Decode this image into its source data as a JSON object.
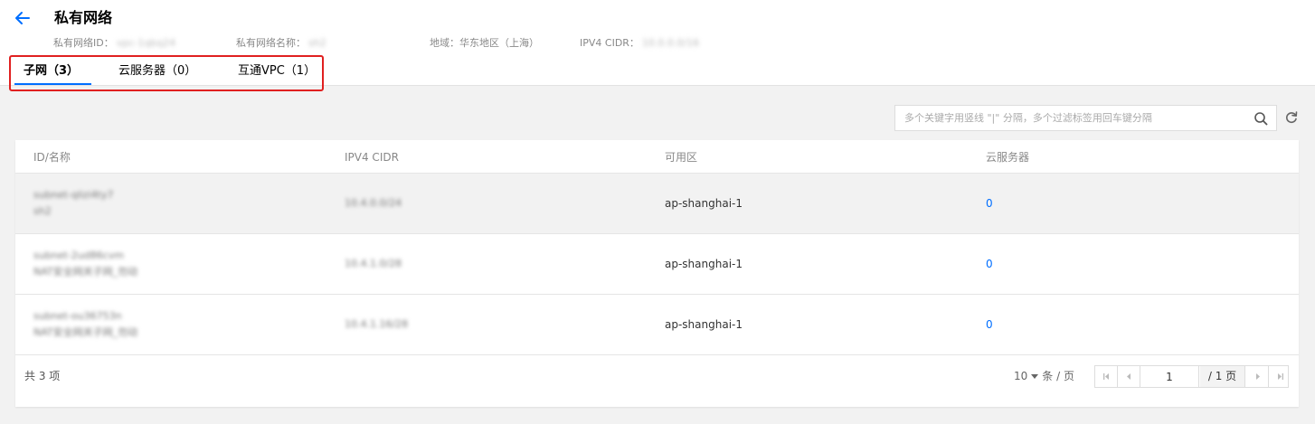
{
  "header": {
    "title": "私有网络",
    "meta": [
      {
        "label": "私有网络ID：",
        "value": "vpc-1qbq24"
      },
      {
        "label": "私有网络名称：",
        "value": "sh2"
      },
      {
        "label": "地域：",
        "value": "华东地区（上海）"
      },
      {
        "label": "IPV4 CIDR：",
        "value": "10.0.0.0/16"
      }
    ]
  },
  "tabs": [
    {
      "label": "子网（3）",
      "active": true
    },
    {
      "label": "云服务器（0）",
      "active": false
    },
    {
      "label": "互通VPC（1）",
      "active": false
    }
  ],
  "search": {
    "placeholder": "多个关键字用竖线 \"|\" 分隔，多个过滤标签用回车键分隔"
  },
  "table": {
    "columns": [
      "ID/名称",
      "IPV4 CIDR",
      "可用区",
      "云服务器"
    ],
    "rows": [
      {
        "id": "subnet-qlizi4ty7",
        "name": "sh2",
        "cidr": "10.4.0.0/24",
        "zone": "ap-shanghai-1",
        "servers": "0"
      },
      {
        "id": "subnet-2ud86cvm",
        "name": "NAT安全网关子网_勿动",
        "cidr": "10.4.1.0/28",
        "zone": "ap-shanghai-1",
        "servers": "0"
      },
      {
        "id": "subnet-ou36753n",
        "name": "NAT安全网关子网_勿动",
        "cidr": "10.4.1.16/28",
        "zone": "ap-shanghai-1",
        "servers": "0"
      }
    ],
    "total_label": "共 3 项"
  },
  "pagination": {
    "page_size": "10",
    "page_size_unit": "条 / 页",
    "current_page": "1",
    "total_pages": "/ 1 页"
  },
  "colors": {
    "accent": "#006eff",
    "highlight": "#e02020"
  },
  "icons": {
    "back": "arrow-left-icon",
    "search": "search-icon",
    "refresh": "refresh-icon"
  }
}
